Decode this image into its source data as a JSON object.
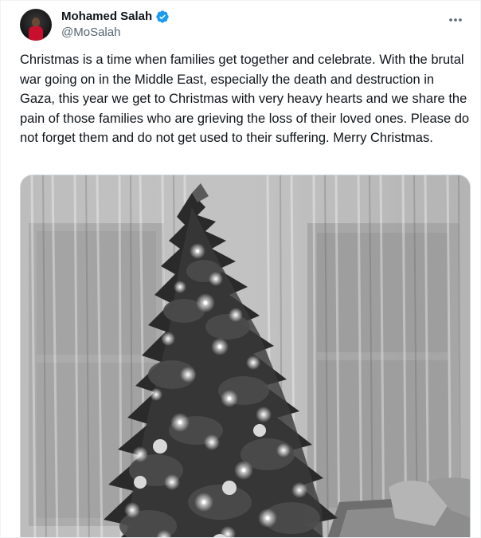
{
  "author": {
    "display_name": "Mohamed Salah",
    "handle": "@MoSalah",
    "verified": true,
    "avatar_icon": "profile-photo-avatar",
    "verified_icon": "verified-badge-icon",
    "verified_color": "#1d9bf0"
  },
  "menu": {
    "icon": "more-options-icon"
  },
  "tweet": {
    "text": "Christmas is a time when families get together and celebrate. With the brutal war going on in the Middle East, especially the death and destruction in Gaza, this year we get to Christmas with very heavy hearts and we share the pain of those families who are grieving the loss of their loved ones. Please do not forget them and do not get used to their suffering. Merry Christmas."
  },
  "media": {
    "kind": "photo",
    "style": "black-and-white"
  },
  "colors": {
    "text": "#0f1419",
    "secondary_text": "#536471",
    "border": "#cfd9de"
  }
}
